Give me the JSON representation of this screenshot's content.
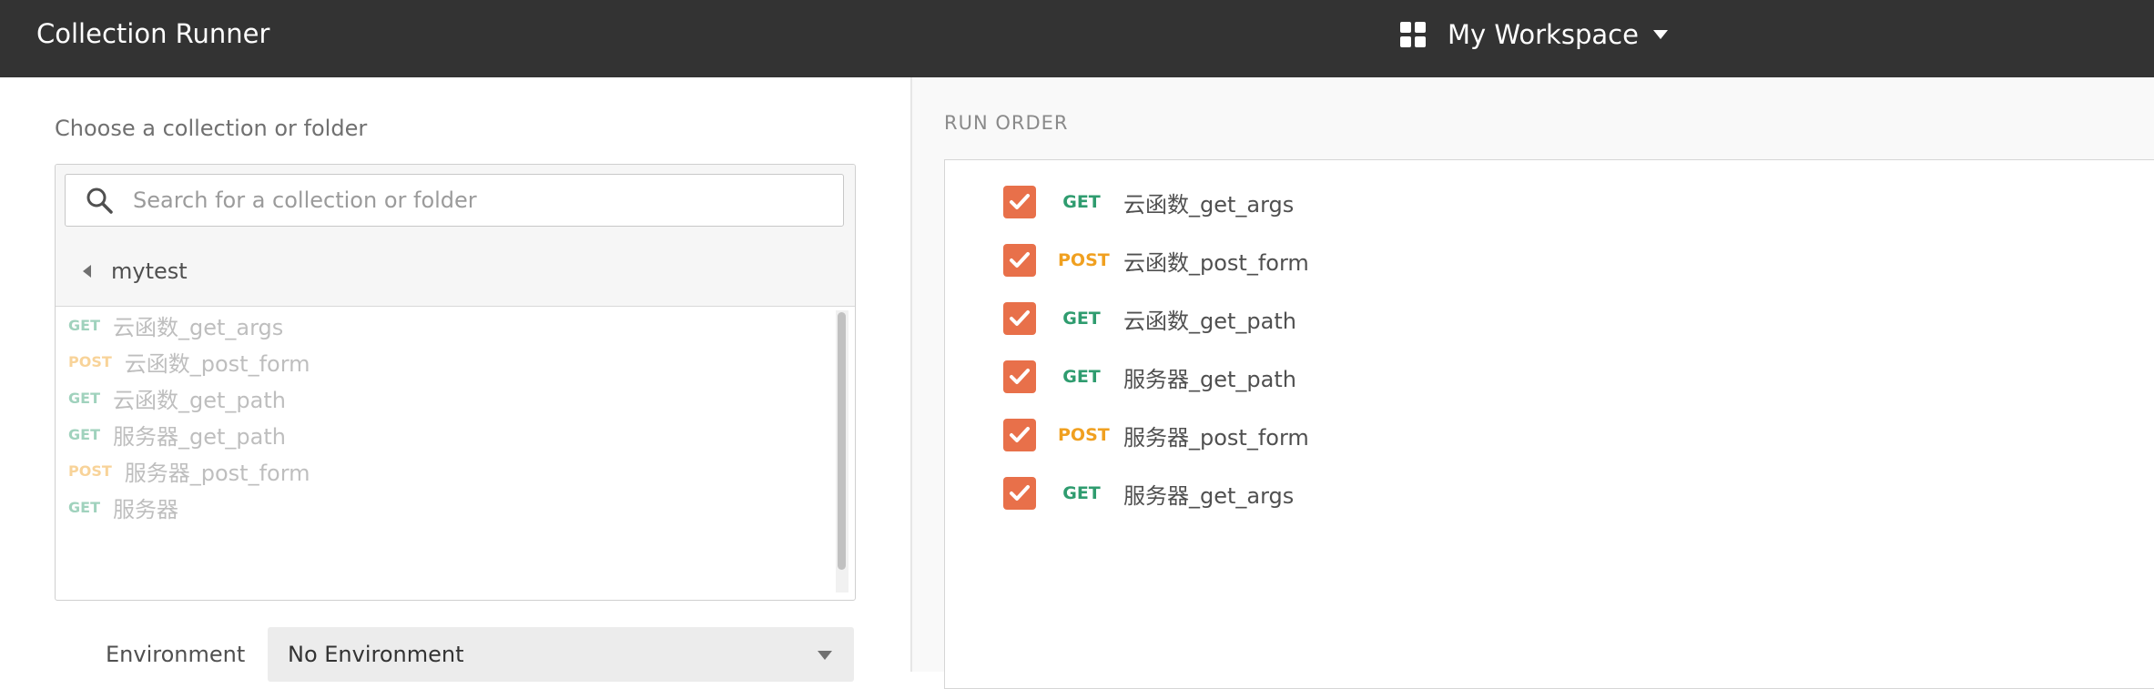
{
  "header": {
    "title": "Collection Runner",
    "workspace": "My Workspace"
  },
  "left": {
    "choose_label": "Choose a collection or folder",
    "search_placeholder": "Search for a collection or folder",
    "collection": "mytest",
    "requests": [
      {
        "method": "GET",
        "name": "云函数_get_args"
      },
      {
        "method": "POST",
        "name": "云函数_post_form"
      },
      {
        "method": "GET",
        "name": "云函数_get_path"
      },
      {
        "method": "GET",
        "name": "服务器_get_path"
      },
      {
        "method": "POST",
        "name": "服务器_post_form"
      },
      {
        "method": "GET",
        "name": "服务器"
      }
    ],
    "environment_label": "Environment",
    "environment_value": "No Environment"
  },
  "run_order": {
    "label": "RUN ORDER",
    "items": [
      {
        "method": "GET",
        "name": "云函数_get_args",
        "checked": true
      },
      {
        "method": "POST",
        "name": "云函数_post_form",
        "checked": true
      },
      {
        "method": "GET",
        "name": "云函数_get_path",
        "checked": true
      },
      {
        "method": "GET",
        "name": "服务器_get_path",
        "checked": true
      },
      {
        "method": "POST",
        "name": "服务器_post_form",
        "checked": true
      },
      {
        "method": "GET",
        "name": "服务器_get_args",
        "checked": true
      }
    ]
  },
  "colors": {
    "header_bg": "#333333",
    "checkbox": "#e8704a",
    "get": "#2f9c6f",
    "post": "#f0a020"
  }
}
